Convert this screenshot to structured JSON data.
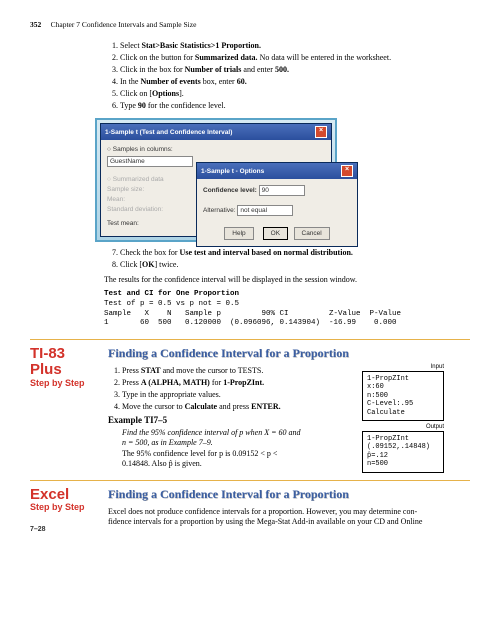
{
  "header": {
    "pagenum": "352",
    "chapter": "Chapter 7   Confidence Intervals and Sample Size"
  },
  "steps_a": {
    "s1a": "Select ",
    "s1b": "Stat>Basic Statistics>1 Proportion.",
    "s2a": "Click on the button for ",
    "s2b": "Summarized data.",
    "s2c": " No data will be entered in the worksheet.",
    "s3a": "Click in the box for ",
    "s3b": "Number of trials",
    "s3c": " and enter ",
    "s3d": "500.",
    "s4a": "In the ",
    "s4b": "Number of events",
    "s4c": " box, enter ",
    "s4d": "60.",
    "s5a": "Click on [",
    "s5b": "Options",
    "s5c": "].",
    "s6a": "Type ",
    "s6b": "90",
    "s6c": " for the confidence level."
  },
  "dlg": {
    "title1": "1-Sample t (Test and Confidence Interval)",
    "samples_col": "Samples in columns:",
    "sample_val": "GuestName",
    "sumdata": "Summarized data",
    "samplesize": "Sample size:",
    "mean": "Mean:",
    "stdev": "Standard deviation:",
    "testmean": "Test mean:",
    "title2": "1-Sample t - Options",
    "conf_lbl": "Confidence level:",
    "conf_val": "90",
    "alt_lbl": "Alternative:",
    "alt_val": "not equal",
    "help": "Help",
    "ok": "OK",
    "cancel": "Cancel"
  },
  "steps_b": {
    "s7a": "Check the box for ",
    "s7b": "Use test and interval based on normal distribution.",
    "s8a": "Click [",
    "s8b": "OK",
    "s8c": "] twice."
  },
  "result_text": "The results for the confidence interval will be displayed in the session window.",
  "mono": {
    "h": "Test and CI for One Proportion",
    "l1": "Test of p = 0.5 vs p not = 0.5",
    "l2": "Sample   X    N   Sample p         90% CI         Z-Value  P-Value",
    "l3": "1       60  500   0.120000  (0.096096, 0.143904)  -16.99    0.000"
  },
  "ti83": {
    "label_main": "TI-83 Plus",
    "label_sub": "Step by Step",
    "title": "Finding a Confidence Interval for a Proportion",
    "s1a": "Press ",
    "s1b": "STAT",
    "s1c": " and move the cursor to TESTS.",
    "s2a": "Press ",
    "s2b": "A (ALPHA, MATH)",
    "s2c": " for ",
    "s2d": "1-PropZInt.",
    "s3": "Type in the appropriate values.",
    "s4a": "Move the cursor to ",
    "s4b": "Calculate",
    "s4c": " and press ",
    "s4d": "ENTER.",
    "example_h": "Example TI7–5",
    "ex1": "Find the 95% confidence interval of p when X = 60 and",
    "ex2": "n = 500, as in Example 7–9.",
    "ex3": "    The 95% confidence level for p is 0.09152 < p <",
    "ex4": "0.14848. Also p̂ is given.",
    "calc_in_lbl": "Input",
    "calc_in": "1-PropZInt\nx:60\nn:500\nC-Level:.95\nCalculate",
    "calc_out_lbl": "Output",
    "calc_out": "1-PropZInt\n(.09152,.14848)\np̂=.12\nn=500"
  },
  "excel": {
    "label_main": "Excel",
    "label_sub": "Step by Step",
    "title": "Finding a Confidence Interval for a Proportion",
    "p1": "Excel does not produce confidence intervals for a proportion. However, you may determine con-",
    "p2": "fidence intervals for a proportion by using the Mega-Stat Add-in available on your CD and Online"
  },
  "footer": "7–28"
}
